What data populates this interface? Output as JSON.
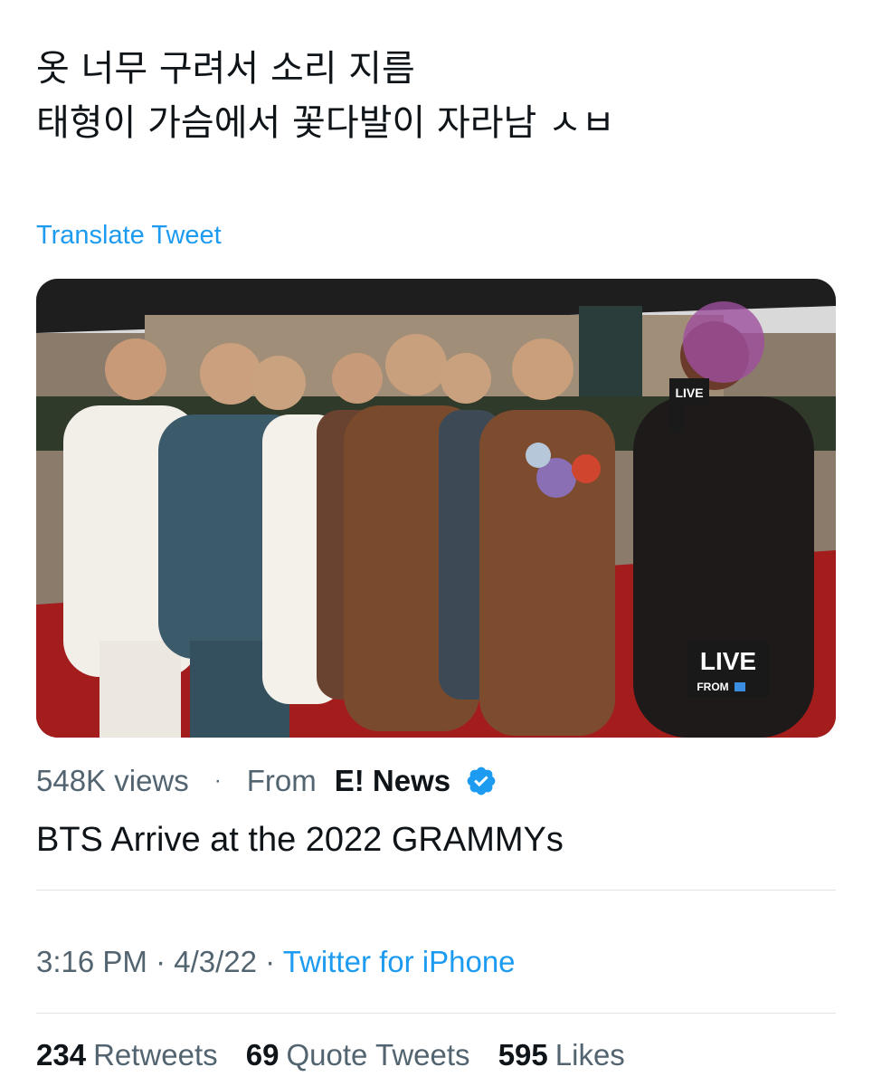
{
  "tweet": {
    "line1": "옷 너무 구려서 소리 지름",
    "line2": "태형이 가슴에서 꽃다발이 자라남 ㅅㅂ",
    "translate_label": "Translate Tweet"
  },
  "media": {
    "live_badge_top": "LIVE",
    "live_badge_bottom": "FROM",
    "mic_flag": "LIVE"
  },
  "video": {
    "views": "548K views",
    "from_label": "From",
    "source": "E! News",
    "title": "BTS Arrive at the 2022 GRAMMYs"
  },
  "meta": {
    "time": "3:16 PM",
    "date": "4/3/22",
    "client": "Twitter for iPhone",
    "separator": "·"
  },
  "stats": {
    "retweets_count": "234",
    "retweets_label": "Retweets",
    "quotes_count": "69",
    "quotes_label": "Quote Tweets",
    "likes_count": "595",
    "likes_label": "Likes"
  },
  "colors": {
    "link": "#1d9bf0",
    "text": "#0f1419",
    "muted": "#536471",
    "verified": "#1d9bf0",
    "divider": "#dfe4e8"
  }
}
